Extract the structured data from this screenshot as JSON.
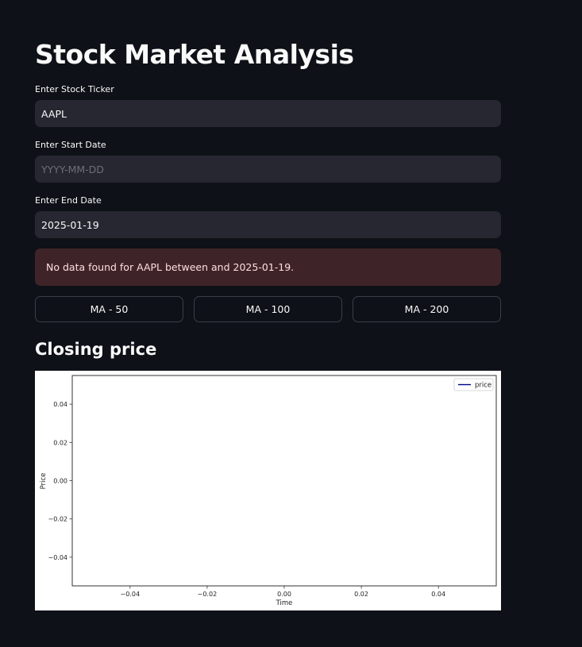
{
  "app": {
    "title": "Stock Market Analysis"
  },
  "form": {
    "ticker": {
      "label": "Enter Stock Ticker",
      "value": "AAPL"
    },
    "start_date": {
      "label": "Enter Start Date",
      "value": "",
      "placeholder": "YYYY-MM-DD"
    },
    "end_date": {
      "label": "Enter End Date",
      "value": "2025-01-19"
    }
  },
  "error": {
    "message": "No data found for AAPL between and 2025-01-19."
  },
  "buttons": {
    "ma50": "MA - 50",
    "ma100": "MA - 100",
    "ma200": "MA - 200"
  },
  "section": {
    "closing_price_title": "Closing price"
  },
  "colors": {
    "background": "#0e1117",
    "input_background": "#262730",
    "error_background": "#3e2428",
    "line_color": "#00008b"
  },
  "chart_data": {
    "type": "line",
    "title": "",
    "xlabel": "Time",
    "ylabel": "Price",
    "xlim": [
      -0.055,
      0.055
    ],
    "ylim": [
      -0.055,
      0.055
    ],
    "x_ticks": [
      -0.04,
      -0.02,
      0.0,
      0.02,
      0.04
    ],
    "x_tick_labels": [
      "−0.04",
      "−0.02",
      "0.00",
      "0.02",
      "0.04"
    ],
    "y_ticks": [
      0.04,
      0.02,
      0.0,
      -0.02,
      -0.04
    ],
    "y_tick_labels": [
      "0.04",
      "0.02",
      "0.00",
      "−0.02",
      "−0.04"
    ],
    "series": [
      {
        "name": "price",
        "x": [],
        "values": [],
        "color": "#00008b"
      }
    ],
    "legend": "top-right",
    "grid": false
  }
}
